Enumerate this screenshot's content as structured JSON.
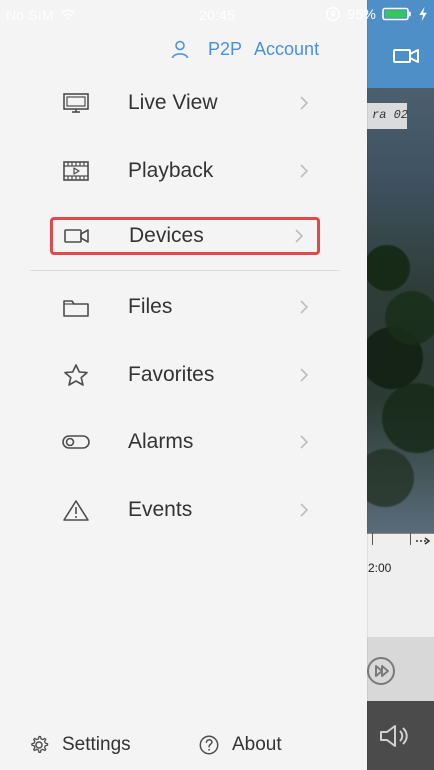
{
  "status_bar": {
    "carrier": "No SIM",
    "time": "20:45",
    "battery_percent": "95%",
    "icons": [
      "wifi-icon",
      "lock-rotation-icon",
      "battery-icon",
      "charging-bolt-icon"
    ]
  },
  "account": {
    "p2p_label": "P2P",
    "account_label": "Account",
    "color": "#4a90e2",
    "icon": "user-icon"
  },
  "menu": {
    "items": [
      {
        "label": "Live View",
        "icon": "monitor-icon"
      },
      {
        "label": "Playback",
        "icon": "film-icon"
      },
      {
        "label": "Devices",
        "icon": "video-camera-icon",
        "highlighted": true
      },
      {
        "label": "Files",
        "icon": "folder-icon"
      },
      {
        "label": "Favorites",
        "icon": "star-icon"
      },
      {
        "label": "Alarms",
        "icon": "toggle-icon"
      },
      {
        "label": "Events",
        "icon": "warning-icon"
      }
    ],
    "highlight_color": "#e04a4a"
  },
  "bottom": {
    "settings_label": "Settings",
    "about_label": "About",
    "settings_icon": "gear-icon",
    "about_icon": "help-icon"
  },
  "background_app": {
    "header_color": "#4f8fc8",
    "video_label_snippet": "ra 02",
    "timeline_time": "2:00"
  }
}
